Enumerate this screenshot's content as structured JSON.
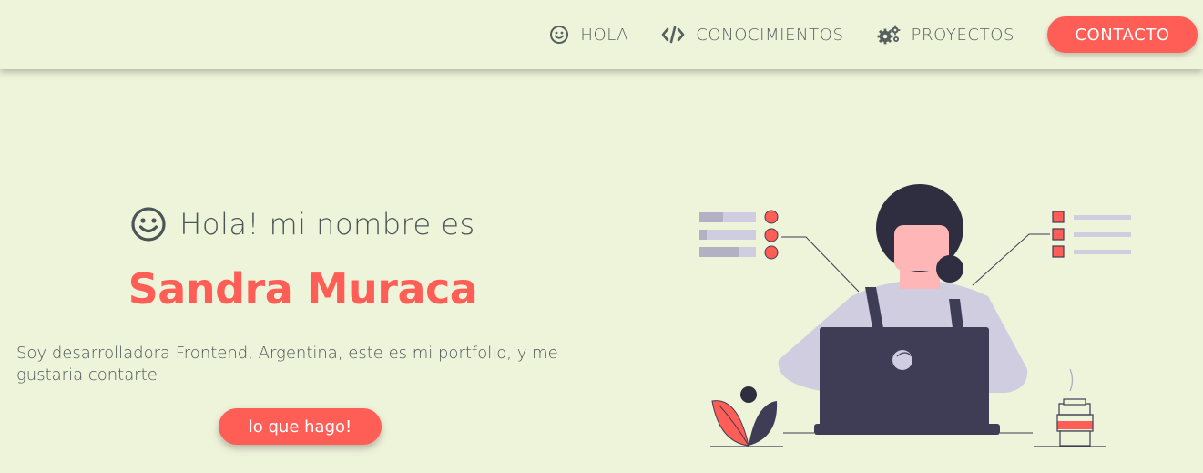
{
  "nav": {
    "items": [
      {
        "label": "HOLA",
        "icon": "smile-icon"
      },
      {
        "label": "CONOCIMIENTOS",
        "icon": "code-icon"
      },
      {
        "label": "PROYECTOS",
        "icon": "gears-icon"
      }
    ],
    "contact_label": "CONTACTO"
  },
  "hero": {
    "greeting": "Hola! mi nombre es",
    "name": "Sandra Muraca",
    "description": "Soy desarrolladora Frontend, Argentina, este es mi portfolio, y me gustaria contarte",
    "cta_label": "lo que hago!"
  },
  "colors": {
    "background": "#eef4da",
    "accent": "#ff5e57",
    "text": "#4b5558",
    "illustration_dark": "#3f3d56",
    "illustration_light": "#d0cde1"
  }
}
